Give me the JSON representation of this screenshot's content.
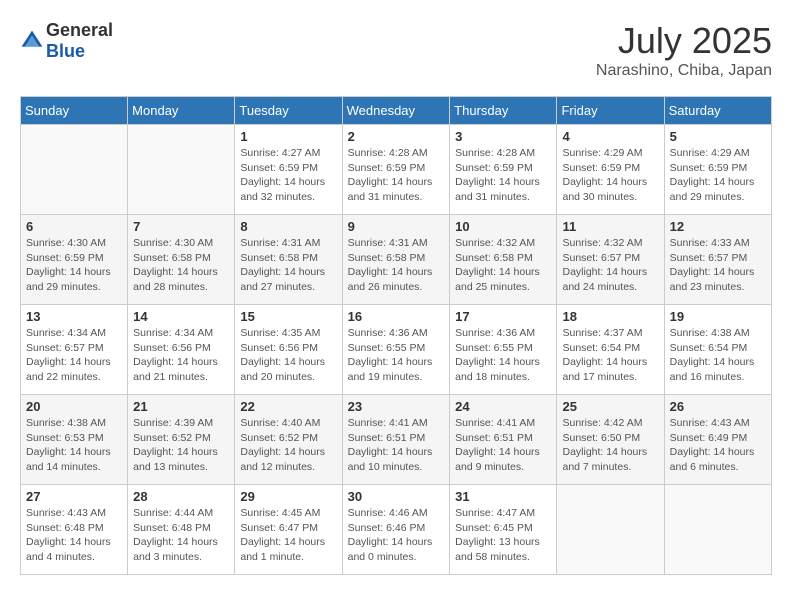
{
  "header": {
    "logo_general": "General",
    "logo_blue": "Blue",
    "title": "July 2025",
    "location": "Narashino, Chiba, Japan"
  },
  "weekdays": [
    "Sunday",
    "Monday",
    "Tuesday",
    "Wednesday",
    "Thursday",
    "Friday",
    "Saturday"
  ],
  "weeks": [
    [
      {
        "day": "",
        "sunrise": "",
        "sunset": "",
        "daylight": ""
      },
      {
        "day": "",
        "sunrise": "",
        "sunset": "",
        "daylight": ""
      },
      {
        "day": "1",
        "sunrise": "Sunrise: 4:27 AM",
        "sunset": "Sunset: 6:59 PM",
        "daylight": "Daylight: 14 hours and 32 minutes."
      },
      {
        "day": "2",
        "sunrise": "Sunrise: 4:28 AM",
        "sunset": "Sunset: 6:59 PM",
        "daylight": "Daylight: 14 hours and 31 minutes."
      },
      {
        "day": "3",
        "sunrise": "Sunrise: 4:28 AM",
        "sunset": "Sunset: 6:59 PM",
        "daylight": "Daylight: 14 hours and 31 minutes."
      },
      {
        "day": "4",
        "sunrise": "Sunrise: 4:29 AM",
        "sunset": "Sunset: 6:59 PM",
        "daylight": "Daylight: 14 hours and 30 minutes."
      },
      {
        "day": "5",
        "sunrise": "Sunrise: 4:29 AM",
        "sunset": "Sunset: 6:59 PM",
        "daylight": "Daylight: 14 hours and 29 minutes."
      }
    ],
    [
      {
        "day": "6",
        "sunrise": "Sunrise: 4:30 AM",
        "sunset": "Sunset: 6:59 PM",
        "daylight": "Daylight: 14 hours and 29 minutes."
      },
      {
        "day": "7",
        "sunrise": "Sunrise: 4:30 AM",
        "sunset": "Sunset: 6:58 PM",
        "daylight": "Daylight: 14 hours and 28 minutes."
      },
      {
        "day": "8",
        "sunrise": "Sunrise: 4:31 AM",
        "sunset": "Sunset: 6:58 PM",
        "daylight": "Daylight: 14 hours and 27 minutes."
      },
      {
        "day": "9",
        "sunrise": "Sunrise: 4:31 AM",
        "sunset": "Sunset: 6:58 PM",
        "daylight": "Daylight: 14 hours and 26 minutes."
      },
      {
        "day": "10",
        "sunrise": "Sunrise: 4:32 AM",
        "sunset": "Sunset: 6:58 PM",
        "daylight": "Daylight: 14 hours and 25 minutes."
      },
      {
        "day": "11",
        "sunrise": "Sunrise: 4:32 AM",
        "sunset": "Sunset: 6:57 PM",
        "daylight": "Daylight: 14 hours and 24 minutes."
      },
      {
        "day": "12",
        "sunrise": "Sunrise: 4:33 AM",
        "sunset": "Sunset: 6:57 PM",
        "daylight": "Daylight: 14 hours and 23 minutes."
      }
    ],
    [
      {
        "day": "13",
        "sunrise": "Sunrise: 4:34 AM",
        "sunset": "Sunset: 6:57 PM",
        "daylight": "Daylight: 14 hours and 22 minutes."
      },
      {
        "day": "14",
        "sunrise": "Sunrise: 4:34 AM",
        "sunset": "Sunset: 6:56 PM",
        "daylight": "Daylight: 14 hours and 21 minutes."
      },
      {
        "day": "15",
        "sunrise": "Sunrise: 4:35 AM",
        "sunset": "Sunset: 6:56 PM",
        "daylight": "Daylight: 14 hours and 20 minutes."
      },
      {
        "day": "16",
        "sunrise": "Sunrise: 4:36 AM",
        "sunset": "Sunset: 6:55 PM",
        "daylight": "Daylight: 14 hours and 19 minutes."
      },
      {
        "day": "17",
        "sunrise": "Sunrise: 4:36 AM",
        "sunset": "Sunset: 6:55 PM",
        "daylight": "Daylight: 14 hours and 18 minutes."
      },
      {
        "day": "18",
        "sunrise": "Sunrise: 4:37 AM",
        "sunset": "Sunset: 6:54 PM",
        "daylight": "Daylight: 14 hours and 17 minutes."
      },
      {
        "day": "19",
        "sunrise": "Sunrise: 4:38 AM",
        "sunset": "Sunset: 6:54 PM",
        "daylight": "Daylight: 14 hours and 16 minutes."
      }
    ],
    [
      {
        "day": "20",
        "sunrise": "Sunrise: 4:38 AM",
        "sunset": "Sunset: 6:53 PM",
        "daylight": "Daylight: 14 hours and 14 minutes."
      },
      {
        "day": "21",
        "sunrise": "Sunrise: 4:39 AM",
        "sunset": "Sunset: 6:52 PM",
        "daylight": "Daylight: 14 hours and 13 minutes."
      },
      {
        "day": "22",
        "sunrise": "Sunrise: 4:40 AM",
        "sunset": "Sunset: 6:52 PM",
        "daylight": "Daylight: 14 hours and 12 minutes."
      },
      {
        "day": "23",
        "sunrise": "Sunrise: 4:41 AM",
        "sunset": "Sunset: 6:51 PM",
        "daylight": "Daylight: 14 hours and 10 minutes."
      },
      {
        "day": "24",
        "sunrise": "Sunrise: 4:41 AM",
        "sunset": "Sunset: 6:51 PM",
        "daylight": "Daylight: 14 hours and 9 minutes."
      },
      {
        "day": "25",
        "sunrise": "Sunrise: 4:42 AM",
        "sunset": "Sunset: 6:50 PM",
        "daylight": "Daylight: 14 hours and 7 minutes."
      },
      {
        "day": "26",
        "sunrise": "Sunrise: 4:43 AM",
        "sunset": "Sunset: 6:49 PM",
        "daylight": "Daylight: 14 hours and 6 minutes."
      }
    ],
    [
      {
        "day": "27",
        "sunrise": "Sunrise: 4:43 AM",
        "sunset": "Sunset: 6:48 PM",
        "daylight": "Daylight: 14 hours and 4 minutes."
      },
      {
        "day": "28",
        "sunrise": "Sunrise: 4:44 AM",
        "sunset": "Sunset: 6:48 PM",
        "daylight": "Daylight: 14 hours and 3 minutes."
      },
      {
        "day": "29",
        "sunrise": "Sunrise: 4:45 AM",
        "sunset": "Sunset: 6:47 PM",
        "daylight": "Daylight: 14 hours and 1 minute."
      },
      {
        "day": "30",
        "sunrise": "Sunrise: 4:46 AM",
        "sunset": "Sunset: 6:46 PM",
        "daylight": "Daylight: 14 hours and 0 minutes."
      },
      {
        "day": "31",
        "sunrise": "Sunrise: 4:47 AM",
        "sunset": "Sunset: 6:45 PM",
        "daylight": "Daylight: 13 hours and 58 minutes."
      },
      {
        "day": "",
        "sunrise": "",
        "sunset": "",
        "daylight": ""
      },
      {
        "day": "",
        "sunrise": "",
        "sunset": "",
        "daylight": ""
      }
    ]
  ]
}
